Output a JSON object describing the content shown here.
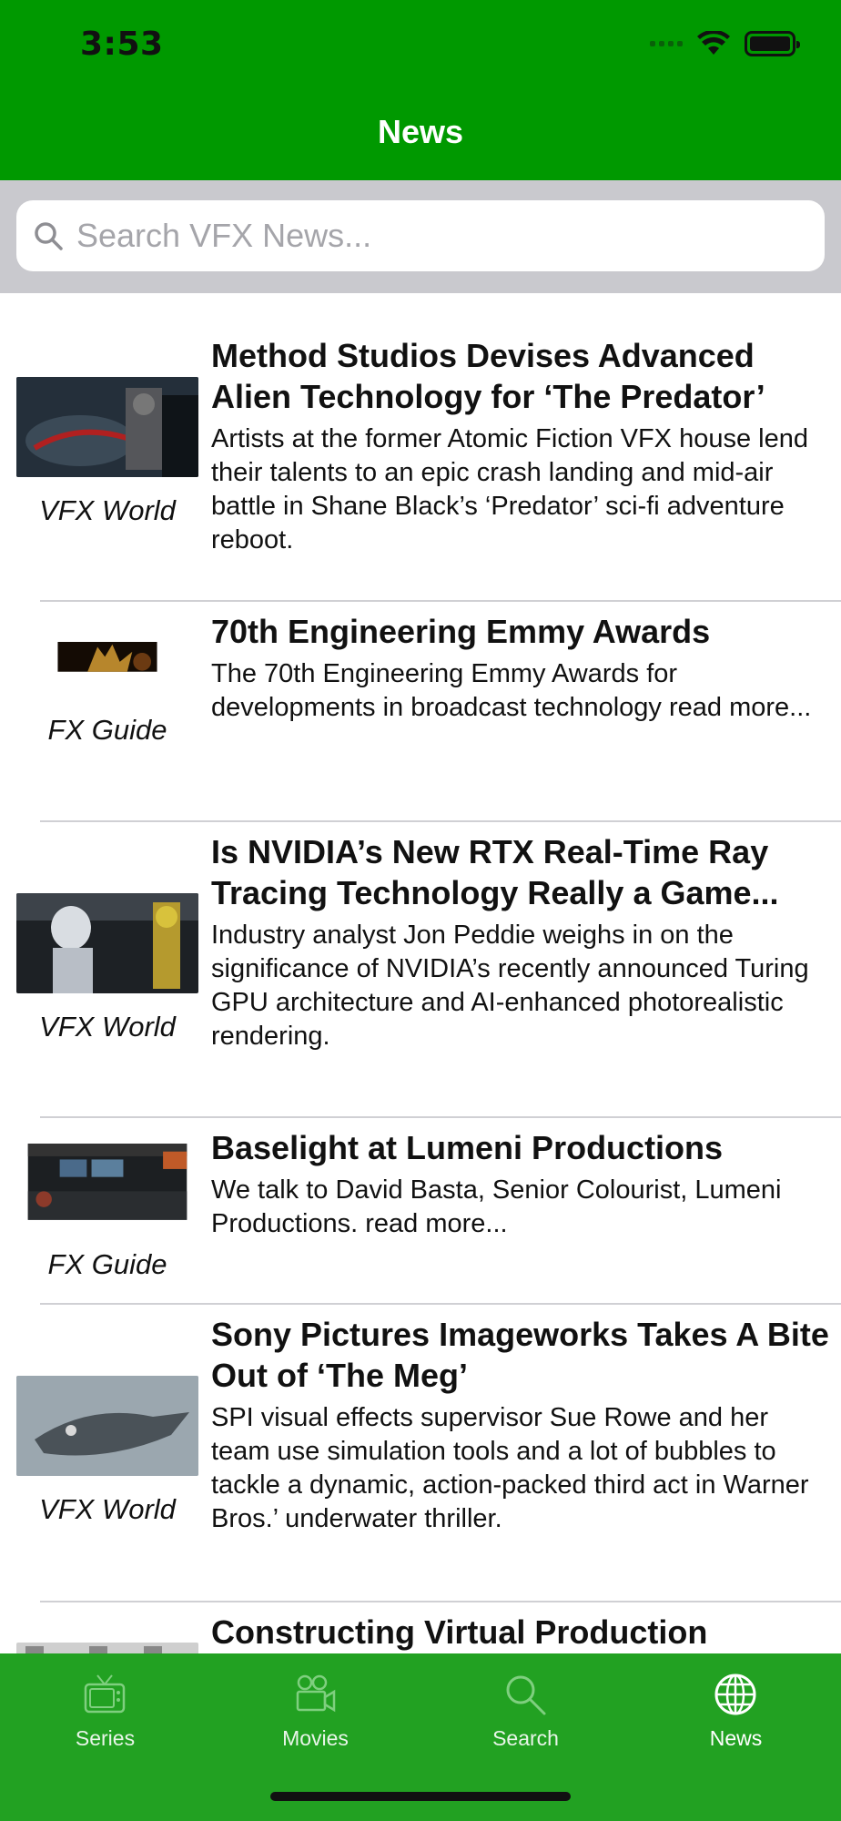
{
  "status": {
    "time": "3:53"
  },
  "nav": {
    "title": "News"
  },
  "search": {
    "placeholder": "Search VFX News...",
    "icon": "search-icon"
  },
  "articles": [
    {
      "title": "Method Studios Devises Advanced Alien Technology for ‘The Predator’",
      "description": "Artists at the former Atomic Fiction VFX house lend their talents to an epic crash landing and mid-air battle in Shane Black’s ‘Predator’ sci-fi adventure reboot.",
      "source": "VFX World"
    },
    {
      "title": "70th Engineering Emmy Awards",
      "description": "The 70th Engineering Emmy Awards for developments in broadcast technology read more...",
      "source": "FX Guide"
    },
    {
      "title": "Is NVIDIA’s New RTX Real-Time Ray Tracing Technology Really a Game...",
      "description": "Industry analyst Jon Peddie weighs in on the significance of NVIDIA’s recently announced Turing GPU architecture and AI-enhanced photorealistic rendering.",
      "source": "VFX World"
    },
    {
      "title": "Baselight at Lumeni Productions",
      "description": "We talk to David Basta, Senior Colourist, Lumeni Productions. read more...",
      "source": "FX Guide"
    },
    {
      "title": "Sony Pictures Imageworks Takes A Bite Out of ‘The Meg’",
      "description": "SPI visual effects supervisor Sue Rowe and her team use simulation tools and a lot of bubbles to tackle a dynamic, action-packed third act in Warner Bros.’ underwater thriller.",
      "source": "VFX World"
    },
    {
      "title": "Constructing Virtual Production"
    }
  ],
  "tabs": [
    {
      "label": "Series",
      "icon": "tv-icon"
    },
    {
      "label": "Movies",
      "icon": "movie-camera-icon"
    },
    {
      "label": "Search",
      "icon": "search-icon"
    },
    {
      "label": "News",
      "icon": "globe-icon",
      "selected": true
    }
  ],
  "colors": {
    "header": "#009900",
    "tabbar": "#22a122",
    "search_bg": "#c9c9ce"
  }
}
